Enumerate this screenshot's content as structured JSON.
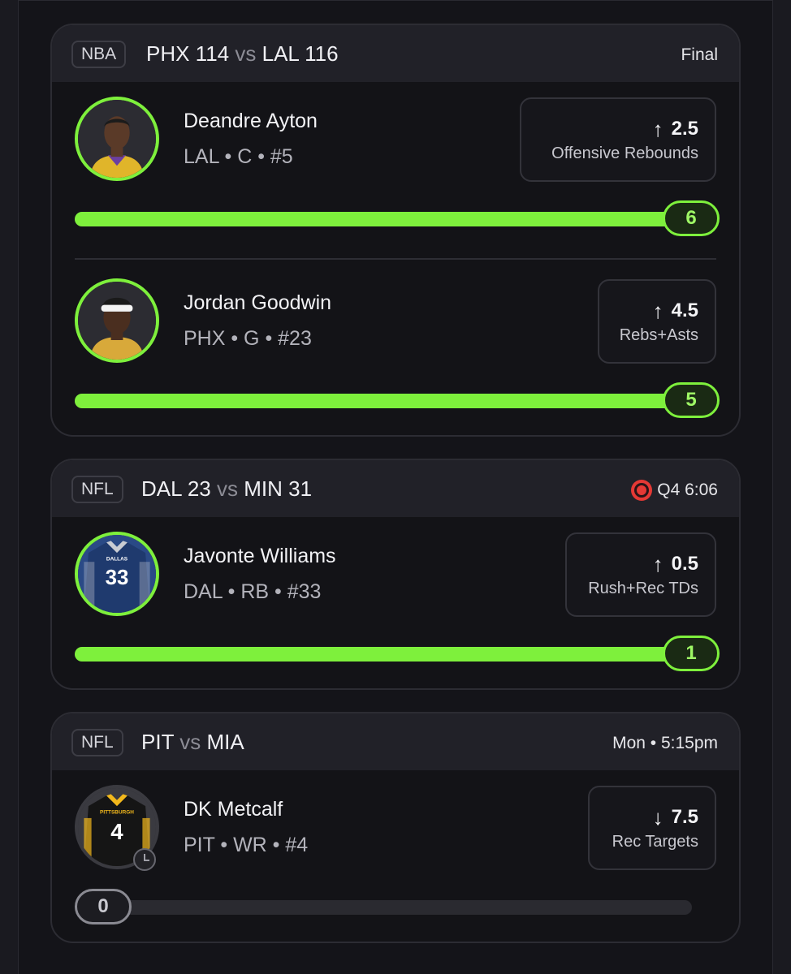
{
  "colors": {
    "accent": "#7ef03c",
    "live": "#e53935",
    "background": "#141419",
    "card": "#131317",
    "header": "#212128"
  },
  "games": [
    {
      "league": "NBA",
      "team1": "PHX 114",
      "vs": "vs",
      "team2": "LAL 116",
      "status": "Final",
      "players": [
        {
          "name": "Deandre Ayton",
          "info": "LAL • C • #5",
          "direction": "↑",
          "line": "2.5",
          "stat": "Offensive Rebounds",
          "current": "6",
          "progress": 1.0
        },
        {
          "name": "Jordan Goodwin",
          "info": "PHX • G • #23",
          "direction": "↑",
          "line": "4.5",
          "stat": "Rebs+Asts",
          "current": "5",
          "progress": 1.0
        }
      ]
    },
    {
      "league": "NFL",
      "team1": "DAL 23",
      "vs": "vs",
      "team2": "MIN 31",
      "status": "Q4 6:06",
      "status_icon": "live-broadcast-icon",
      "players": [
        {
          "name": "Javonte Williams",
          "info": "DAL • RB • #33",
          "direction": "↑",
          "line": "0.5",
          "stat": "Rush+Rec TDs",
          "current": "1",
          "progress": 1.0,
          "jersey_text": "DALLAS",
          "jersey_number": "33"
        }
      ]
    },
    {
      "league": "NFL",
      "team1": "PIT",
      "vs": "vs",
      "team2": "MIA",
      "status": "Mon • 5:15pm",
      "players": [
        {
          "name": "DK Metcalf",
          "info": "PIT • WR • #4",
          "direction": "↓",
          "line": "7.5",
          "stat": "Rec Targets",
          "current": "0",
          "progress": 0.0,
          "jersey_text": "PITTSBURGH",
          "jersey_number": "4",
          "avatar_badge": "clock-icon"
        }
      ]
    }
  ]
}
